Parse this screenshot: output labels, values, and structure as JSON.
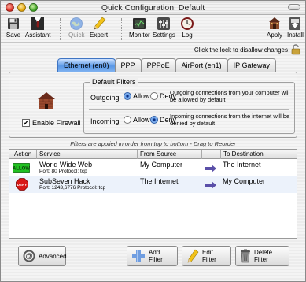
{
  "window": {
    "title": "Quick Configuration: Default"
  },
  "toolbar": {
    "items": [
      {
        "label": "Save",
        "icon": "save-icon",
        "enabled": true
      },
      {
        "label": "Assistant",
        "icon": "assistant-icon",
        "enabled": true
      },
      {
        "label": "Quick",
        "icon": "quick-globe-icon",
        "enabled": false
      },
      {
        "label": "Expert",
        "icon": "expert-pencil-icon",
        "enabled": true
      },
      {
        "label": "Monitor",
        "icon": "monitor-icon",
        "enabled": true
      },
      {
        "label": "Settings",
        "icon": "settings-icon",
        "enabled": true
      },
      {
        "label": "Log",
        "icon": "log-clock-icon",
        "enabled": true
      },
      {
        "label": "Apply",
        "icon": "apply-icon",
        "enabled": true
      },
      {
        "label": "Install",
        "icon": "install-icon",
        "enabled": true
      }
    ]
  },
  "lock": {
    "text": "Click the lock to disallow changes",
    "state": "unlocked"
  },
  "tabs": [
    {
      "label": "Ethernet (en0)",
      "active": true
    },
    {
      "label": "PPP",
      "active": false
    },
    {
      "label": "PPPoE",
      "active": false
    },
    {
      "label": "AirPort (en1)",
      "active": false
    },
    {
      "label": "IP Gateway",
      "active": false
    }
  ],
  "firewall": {
    "enable_label": "Enable Firewall",
    "enabled": true,
    "check_mark": "✔"
  },
  "default_filters": {
    "title": "Default Filters",
    "outgoing": {
      "label": "Outgoing",
      "allow_label": "Allow",
      "deny_label": "Deny",
      "selected": "allow",
      "description": "Outgoing connections from your computer will be allowed by default"
    },
    "incoming": {
      "label": "Incoming",
      "allow_label": "Allow",
      "deny_label": "Deny",
      "selected": "deny",
      "description": "Incoming connections from the internet will be denied by default"
    }
  },
  "order_note": "Filters are applied in order from top to bottom - Drag to Reorder",
  "table": {
    "headers": {
      "action": "Action",
      "service": "Service",
      "source": "From Source",
      "destination": "To Destination"
    },
    "rows": [
      {
        "action": "ALLOW",
        "action_color": "#22c022",
        "service": "World Wide Web",
        "port_protocol": "Port: 80  Protocol: tcp",
        "source": "My Computer",
        "destination": "The Internet"
      },
      {
        "action": "DENY",
        "action_color": "#d81818",
        "service": "SubSeven Hack",
        "port_protocol": "Port: 1243,6776  Protocol: tcp",
        "source": "The Internet",
        "destination": "My Computer"
      }
    ]
  },
  "buttons": {
    "advanced": "Advanced",
    "add_filter": "Add Filter",
    "edit_filter": "Edit Filter",
    "delete_filter": "Delete Filter"
  },
  "colors": {
    "tab_active": "#5a98e6",
    "radio_selected": "#2e5ea8",
    "arrow": "#5a4fa8"
  }
}
